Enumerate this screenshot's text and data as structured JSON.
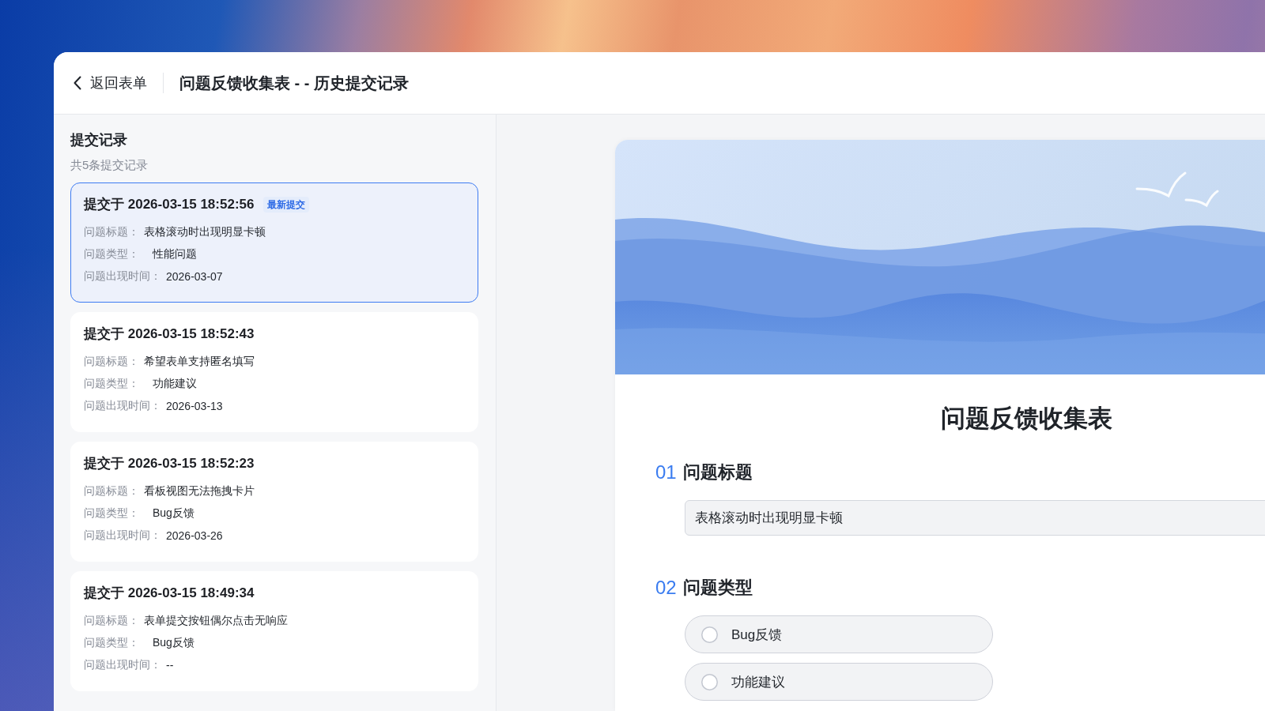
{
  "header": {
    "back_label": "返回表单",
    "title": "问题反馈收集表 - - 历史提交记录"
  },
  "sidebar": {
    "title": "提交记录",
    "count": "共5条提交记录",
    "records": [
      {
        "submitted": "提交于 2026-03-15 18:52:56",
        "badge": "最新提交",
        "selected": true,
        "fields": [
          {
            "label": "问题标题：",
            "value": "表格滚动时出现明显卡顿",
            "kind": "text"
          },
          {
            "label": "问题类型：",
            "value": "性能问题",
            "kind": "tag"
          },
          {
            "label": "问题出现时间：",
            "value": "2026-03-07",
            "kind": "text"
          }
        ]
      },
      {
        "submitted": "提交于 2026-03-15 18:52:43",
        "selected": false,
        "fields": [
          {
            "label": "问题标题：",
            "value": "希望表单支持匿名填写",
            "kind": "text"
          },
          {
            "label": "问题类型：",
            "value": "功能建议",
            "kind": "tag"
          },
          {
            "label": "问题出现时间：",
            "value": "2026-03-13",
            "kind": "text"
          }
        ]
      },
      {
        "submitted": "提交于 2026-03-15 18:52:23",
        "selected": false,
        "fields": [
          {
            "label": "问题标题：",
            "value": "看板视图无法拖拽卡片",
            "kind": "text"
          },
          {
            "label": "问题类型：",
            "value": "Bug反馈",
            "kind": "tag"
          },
          {
            "label": "问题出现时间：",
            "value": "2026-03-26",
            "kind": "text"
          }
        ]
      },
      {
        "submitted": "提交于 2026-03-15 18:49:34",
        "selected": false,
        "fields": [
          {
            "label": "问题标题：",
            "value": "表单提交按钮偶尔点击无响应",
            "kind": "text"
          },
          {
            "label": "问题类型：",
            "value": "Bug反馈",
            "kind": "tag"
          },
          {
            "label": "问题出现时间：",
            "value": "--",
            "kind": "text"
          }
        ]
      }
    ]
  },
  "form": {
    "title": "问题反馈收集表",
    "questions": [
      {
        "number": "01",
        "label": "问题标题",
        "kind": "text",
        "value": "表格滚动时出现明显卡顿"
      },
      {
        "number": "02",
        "label": "问题类型",
        "kind": "choice",
        "options": [
          {
            "label": "Bug反馈",
            "selected": false
          },
          {
            "label": "功能建议",
            "selected": false
          }
        ]
      }
    ]
  }
}
